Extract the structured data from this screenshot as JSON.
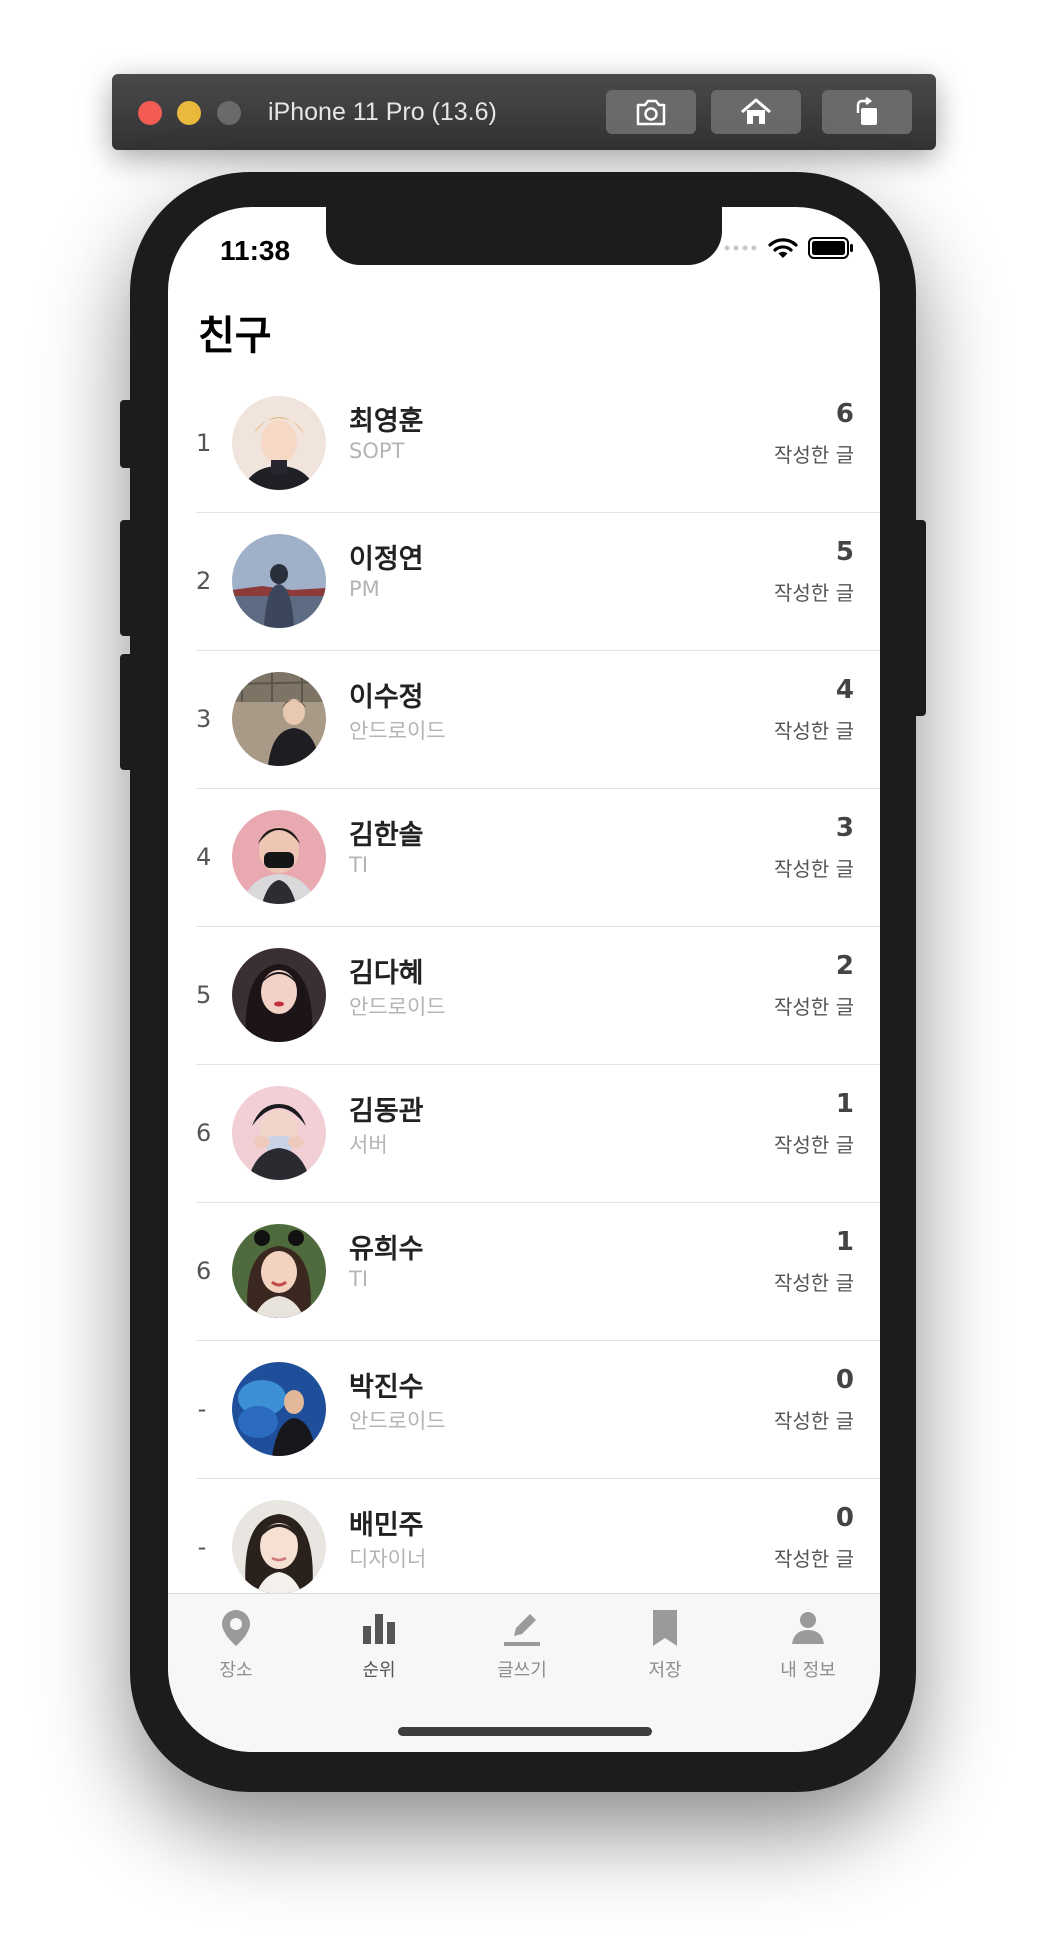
{
  "simulator": {
    "title": "iPhone 11 Pro (13.6)"
  },
  "status_bar": {
    "time": "11:38"
  },
  "page": {
    "title": "친구"
  },
  "friends": [
    {
      "rank": "1",
      "name": "최영훈",
      "dept": "SOPT",
      "count": "6",
      "count_label": "작성한 글"
    },
    {
      "rank": "2",
      "name": "이정연",
      "dept": "PM",
      "count": "5",
      "count_label": "작성한 글"
    },
    {
      "rank": "3",
      "name": "이수정",
      "dept": "안드로이드",
      "count": "4",
      "count_label": "작성한 글"
    },
    {
      "rank": "4",
      "name": "김한솔",
      "dept": "TI",
      "count": "3",
      "count_label": "작성한 글"
    },
    {
      "rank": "5",
      "name": "김다혜",
      "dept": "안드로이드",
      "count": "2",
      "count_label": "작성한 글"
    },
    {
      "rank": "6",
      "name": "김동관",
      "dept": "서버",
      "count": "1",
      "count_label": "작성한 글"
    },
    {
      "rank": "6",
      "name": "유희수",
      "dept": "TI",
      "count": "1",
      "count_label": "작성한 글"
    },
    {
      "rank": "-",
      "name": "박진수",
      "dept": "안드로이드",
      "count": "0",
      "count_label": "작성한 글"
    },
    {
      "rank": "-",
      "name": "배민주",
      "dept": "디자이너",
      "count": "0",
      "count_label": "작성한 글"
    }
  ],
  "tabbar": {
    "tabs": [
      {
        "label": "장소",
        "icon": "place-pin-icon"
      },
      {
        "label": "순위",
        "icon": "bar-chart-icon",
        "active": true
      },
      {
        "label": "글쓰기",
        "icon": "pencil-icon"
      },
      {
        "label": "저장",
        "icon": "bookmark-icon"
      },
      {
        "label": "내 정보",
        "icon": "person-icon"
      }
    ]
  },
  "colors": {
    "active_tab": "#555555",
    "inactive_tab": "#9a9a9a",
    "secondary_text": "#b4b4b4"
  }
}
